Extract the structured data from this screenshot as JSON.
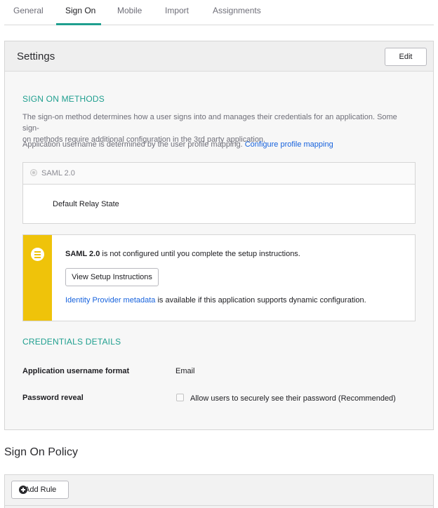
{
  "tabs": [
    {
      "label": "General"
    },
    {
      "label": "Sign On"
    },
    {
      "label": "Mobile"
    },
    {
      "label": "Import"
    },
    {
      "label": "Assignments"
    }
  ],
  "active_tab": "Sign On",
  "settings": {
    "title": "Settings",
    "edit_label": "Edit"
  },
  "sign_on_methods": {
    "heading": "SIGN ON METHODS",
    "description_line1": "The sign-on method determines how a user signs into and manages their credentials for an application. Some sign-",
    "description_line2": "on methods require additional configuration in the 3rd party application.",
    "username_text": "Application username is determined by the user profile mapping.",
    "configure_link": "Configure profile mapping",
    "method_label": "SAML 2.0",
    "relay_state_label": "Default Relay State"
  },
  "notice": {
    "bold_text": "SAML 2.0",
    "text": " is not configured until you complete the setup instructions.",
    "button_label": "View Setup Instructions",
    "metadata_link": "Identity Provider metadata",
    "metadata_text": " is available if this application supports dynamic configuration."
  },
  "credentials": {
    "heading": "CREDENTIALS DETAILS",
    "username_format_label": "Application username format",
    "username_format_value": "Email",
    "password_reveal_label": "Password reveal",
    "password_reveal_option": "Allow users to securely see their password (Recommended)",
    "password_reveal_checked": false
  },
  "policy": {
    "title": "Sign On Policy",
    "add_rule_label": "Add Rule"
  },
  "colors": {
    "accent": "#1f9f8f",
    "link": "#1662dd",
    "notice": "#efc30a"
  }
}
